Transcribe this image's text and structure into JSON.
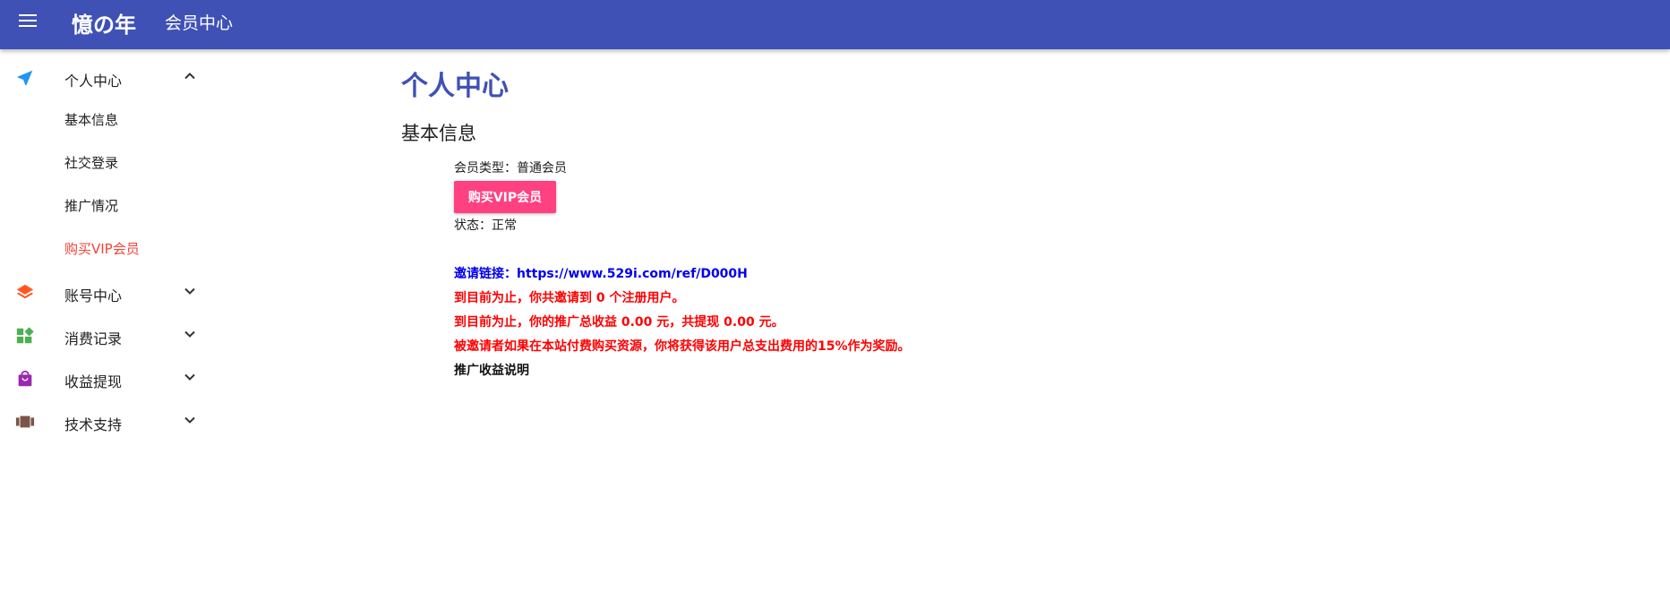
{
  "header": {
    "brand": "憶の年",
    "title": "会员中心",
    "menu_icon": "hamburger-menu-icon",
    "color": "#3f51b5"
  },
  "sidebar": {
    "groups": [
      {
        "label": "个人中心",
        "icon": "navigation-arrow-icon",
        "icon_color": "#2196f3",
        "expanded": true,
        "items": [
          {
            "label": "基本信息",
            "active": false
          },
          {
            "label": "社交登录",
            "active": false
          },
          {
            "label": "推广情况",
            "active": false
          },
          {
            "label": "购买VIP会员",
            "active": true
          }
        ]
      },
      {
        "label": "账号中心",
        "icon": "layers-icon",
        "icon_color": "#ff5722",
        "expanded": false
      },
      {
        "label": "消费记录",
        "icon": "widgets-icon",
        "icon_color": "#4caf50",
        "expanded": false
      },
      {
        "label": "收益提现",
        "icon": "shopping-bag-icon",
        "icon_color": "#9c27b0",
        "expanded": false
      },
      {
        "label": "技术支持",
        "icon": "card-stack-icon",
        "icon_color": "#795548",
        "expanded": false
      }
    ]
  },
  "main": {
    "page_title": "个人中心",
    "section_title": "基本信息",
    "member_type": "会员类型：普通会员",
    "buy_vip_label": "购买VIP会员",
    "buy_vip_color": "#ff4081",
    "status": "状态：正常",
    "invite_label": "邀请链接：",
    "invite_url": "https://www.529i.com/ref/D000H",
    "invited_count_text": "到目前为止，你共邀请到 0 个注册用户。",
    "earnings_text": "到目前为止，你的推广总收益 0.00 元，共提现 0.00 元。",
    "reward_text": "被邀请者如果在本站付费购买资源，你将获得该用户总支出费用的15%作为奖励。",
    "promo_note": "推广收益说明"
  }
}
